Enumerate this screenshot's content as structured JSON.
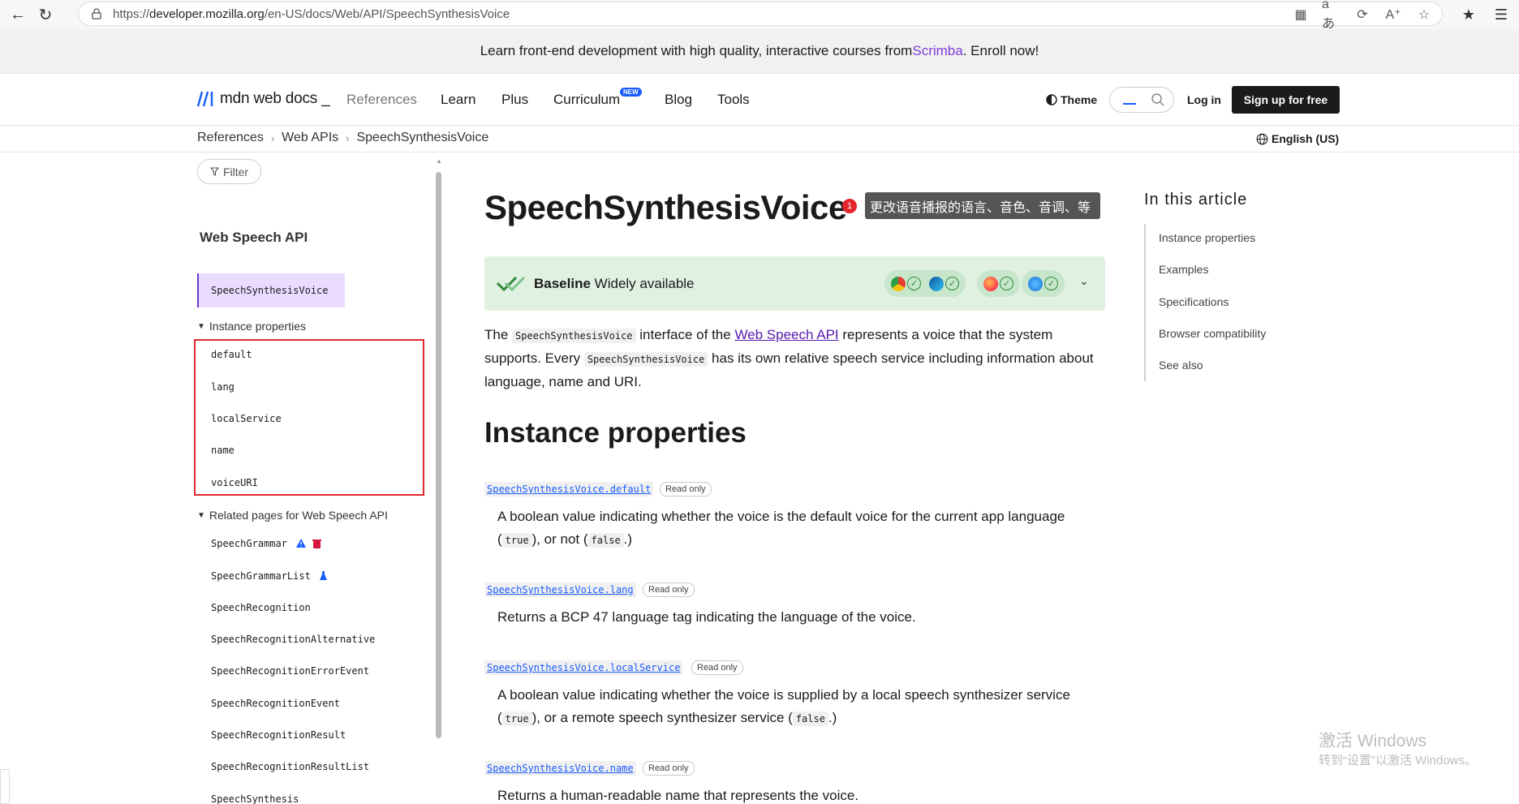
{
  "browser": {
    "url_prefix": "https://",
    "url_domain": "developer.mozilla.org",
    "url_path": "/en-US/docs/Web/API/SpeechSynthesisVoice"
  },
  "promo": {
    "text_before": "Learn front-end development with high quality, interactive courses from ",
    "link": "Scrimba",
    "text_after": ". Enroll now!"
  },
  "header": {
    "logo": "mdn web docs",
    "logo_cursor": "_",
    "nav": [
      "References",
      "Learn",
      "Plus",
      "Curriculum",
      "Blog",
      "Tools"
    ],
    "new_badge": "NEW",
    "theme": "Theme",
    "login": "Log in",
    "signup": "Sign up for free"
  },
  "breadcrumb": {
    "items": [
      "References",
      "Web APIs",
      "SpeechSynthesisVoice"
    ],
    "language": "English (US)"
  },
  "sidebar": {
    "filter": "Filter",
    "title": "Web Speech API",
    "active": "SpeechSynthesisVoice",
    "instance_toggle": "Instance properties",
    "instance_items": [
      "default",
      "lang",
      "localService",
      "name",
      "voiceURI"
    ],
    "related_toggle": "Related pages for Web Speech API",
    "related_items": [
      "SpeechGrammar",
      "SpeechGrammarList",
      "SpeechRecognition",
      "SpeechRecognitionAlternative",
      "SpeechRecognitionErrorEvent",
      "SpeechRecognitionEvent",
      "SpeechRecognitionResult",
      "SpeechRecognitionResultList",
      "SpeechSynthesis"
    ]
  },
  "article": {
    "title": "SpeechSynthesisVoice",
    "tip_number": "1",
    "tooltip": "更改语音播报的语言、音色、音调、等",
    "baseline_strong": "Baseline",
    "baseline_rest": "Widely available",
    "intro": {
      "p1": "The ",
      "code1": "SpeechSynthesisVoice",
      "p2": " interface of the ",
      "link": "Web Speech API",
      "p3": " represents a voice that the system supports. Every ",
      "code2": "SpeechSynthesisVoice",
      "p4": " has its own relative speech service including information about language, name and URI."
    },
    "h2": "Instance properties",
    "read_only": "Read only",
    "props": [
      {
        "name": "SpeechSynthesisVoice.default",
        "d1": "A boolean value indicating whether the voice is the default voice for the current app language (",
        "c1": "true",
        "d2": "), or not (",
        "c2": "false",
        "d3": ".)"
      },
      {
        "name": "SpeechSynthesisVoice.lang",
        "d1": "Returns a BCP 47 language tag indicating the language of the voice."
      },
      {
        "name": "SpeechSynthesisVoice.localService",
        "d1": "A boolean value indicating whether the voice is supplied by a local speech synthesizer service (",
        "c1": "true",
        "d2": "), or a remote speech synthesizer service (",
        "c2": "false",
        "d3": ".)"
      },
      {
        "name": "SpeechSynthesisVoice.name",
        "d1": "Returns a human-readable name that represents the voice."
      }
    ]
  },
  "toc": {
    "title": "In this article",
    "items": [
      "Instance properties",
      "Examples",
      "Specifications",
      "Browser compatibility",
      "See also"
    ]
  },
  "watermark": {
    "line1": "激活 Windows",
    "line2": "转到“设置”以激活 Windows。"
  },
  "colors": {
    "accent": "#1a5cff",
    "purple_link": "#551ab0",
    "baseline_bg": "#e0f1e2",
    "highlight_red": "#e0282e"
  }
}
